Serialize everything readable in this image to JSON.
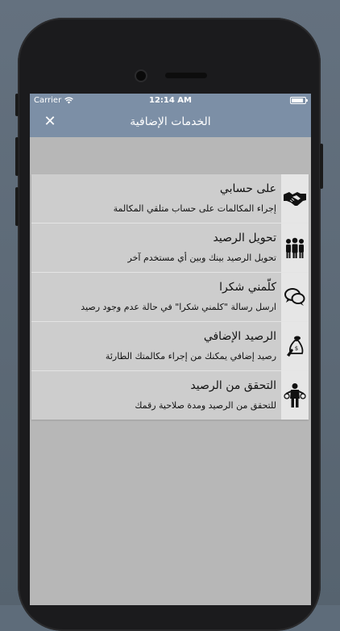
{
  "statusbar": {
    "carrier": "Carrier",
    "time": "12:14 AM"
  },
  "navbar": {
    "title": "الخدمات الإضافية",
    "close_icon": "close-icon",
    "close_glyph": "✕"
  },
  "services": [
    {
      "title": "على حسابي",
      "description": "إجراء المكالمات على حساب متلقي المكالمة",
      "icon": "handshake-icon"
    },
    {
      "title": "تحويل الرصيد",
      "description": "تحويل الرصيد بينك وبين أي مستخدم آخر",
      "icon": "people-group-icon"
    },
    {
      "title": "كلّمني شكرا",
      "description": "ارسل رسالة \"كلمني شكرا\" في حالة عدم وجود رصيد",
      "icon": "chat-bubbles-icon"
    },
    {
      "title": "الرصيد الإضافي",
      "description": "رصيد إضافي يمكنك من إجراء مكالمتك الطارئة",
      "icon": "money-bag-icon"
    },
    {
      "title": "التحقق من الرصيد",
      "description": "للتحقق من الرصيد ومدة صلاحية رقمك",
      "icon": "person-balance-icon"
    }
  ],
  "colors": {
    "navbar": "#7c8fa6",
    "background": "#b7b7b7",
    "row": "#cdcdcd",
    "icon_box": "#e6e6e6"
  }
}
